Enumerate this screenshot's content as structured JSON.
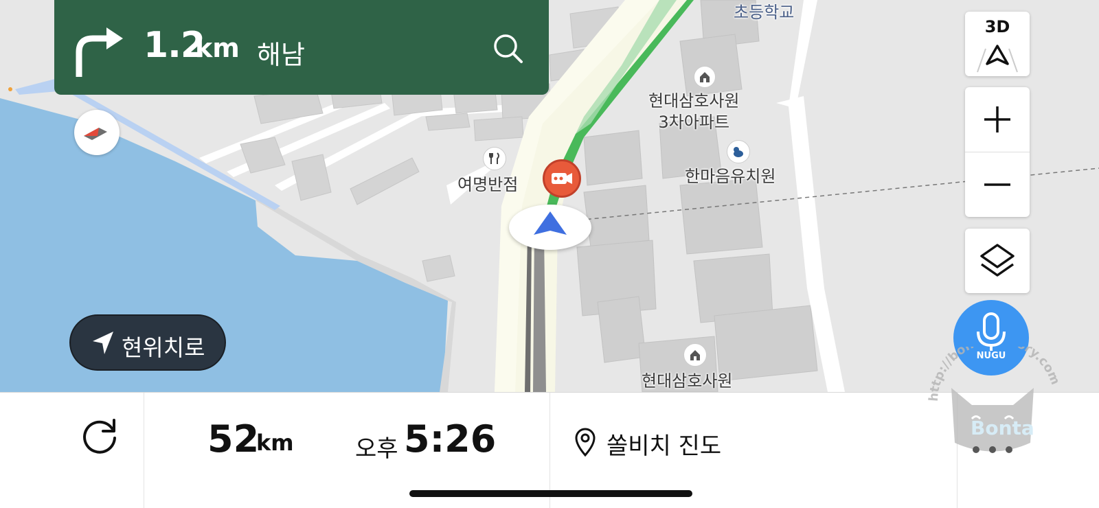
{
  "guidance": {
    "distance_value": "1.2",
    "distance_unit": "km",
    "direction_name": "해남",
    "turn": "right-turn-icon"
  },
  "map": {
    "labels": {
      "school": "초등학교",
      "apartment_3": "현대삼호사원\n3차아파트",
      "kindergarten": "한마음유치원",
      "restaurant": "여명반점",
      "apartment": "현대삼호사원"
    },
    "route_color": "#4cc15d",
    "water_color": "#8fbfe3"
  },
  "controls": {
    "view_3d_label": "3D",
    "zoom_in": "plus-icon",
    "zoom_out": "minus-icon",
    "layers": "layers-icon",
    "voice_label": "NUGU"
  },
  "current_location": {
    "label": "현위치로"
  },
  "bottom_bar": {
    "remaining_distance_value": "52",
    "remaining_distance_unit": "km",
    "arrival_ampm": "오후",
    "arrival_time": "5:26",
    "destination": "쏠비치 진도"
  },
  "watermark": {
    "url_text": "http://bonta.tistory.com",
    "name": "Bonta"
  }
}
